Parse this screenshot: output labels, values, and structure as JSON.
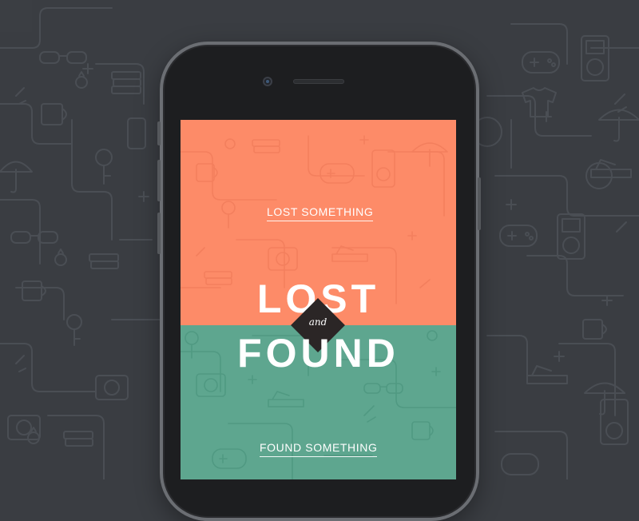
{
  "app": {
    "logo_top": "LOST",
    "logo_connector": "and",
    "logo_bottom": "FOUND"
  },
  "nav": {
    "lost_label": "LOST SOMETHING",
    "found_label": "FOUND SOMETHING"
  },
  "colors": {
    "background": "#3a3d42",
    "coral": "#fd8b68",
    "teal": "#5ea68f",
    "diamond": "#2b2626",
    "text": "#ffffff"
  },
  "icons": [
    "sunglasses-icon",
    "mug-icon",
    "key-icon",
    "camera-icon",
    "gamepad-icon",
    "ipod-icon",
    "umbrella-icon",
    "shoe-icon",
    "books-icon",
    "ring-icon",
    "tshirt-icon",
    "phone-icon",
    "sparkle-icon"
  ]
}
